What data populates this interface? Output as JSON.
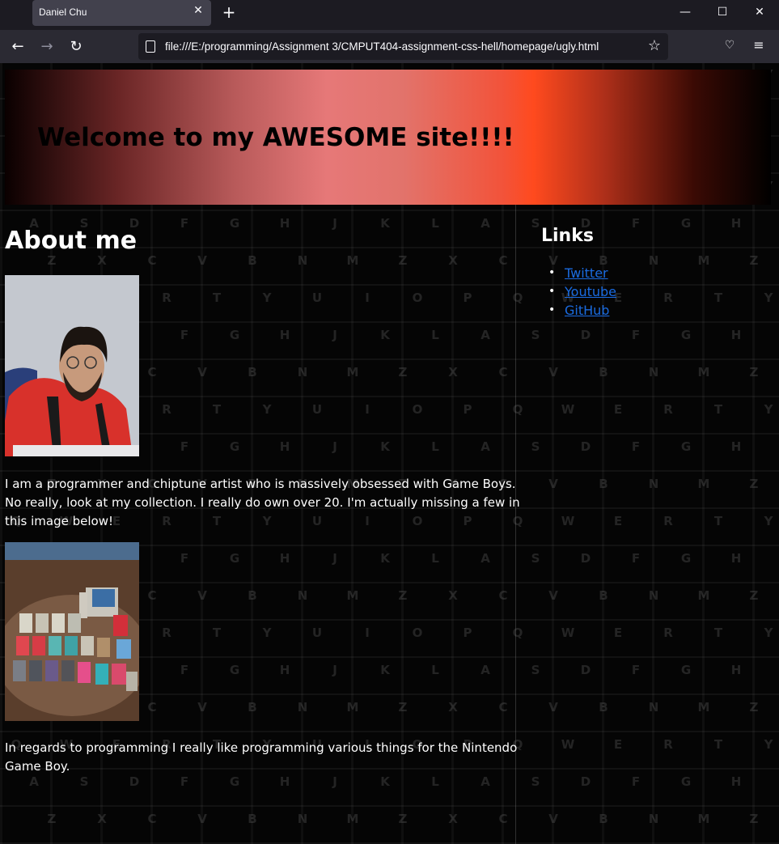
{
  "browser": {
    "tab_title": "Daniel Chu",
    "url": "file:///E:/programming/Assignment 3/CMPUT404-assignment-css-hell/homepage/ugly.html"
  },
  "page": {
    "banner_title": "Welcome to my AWESOME site!!!!",
    "about_heading": "About me",
    "paragraph_1": "I am a programmer and chiptune artist who is massively obsessed with Game Boys. No really, look at my collection. I really do own over 20. I'm actually missing a few in this image below!",
    "paragraph_2": "In regards to programming I really like programming various things for the Nintendo Game Boy.",
    "links_heading": "Links",
    "links": [
      {
        "label": "Twitter"
      },
      {
        "label": "Youtube"
      },
      {
        "label": "GitHub"
      }
    ]
  },
  "colors": {
    "link": "#1a6be0",
    "text": "#ffffff",
    "banner_accent": "#ff4a1e"
  }
}
